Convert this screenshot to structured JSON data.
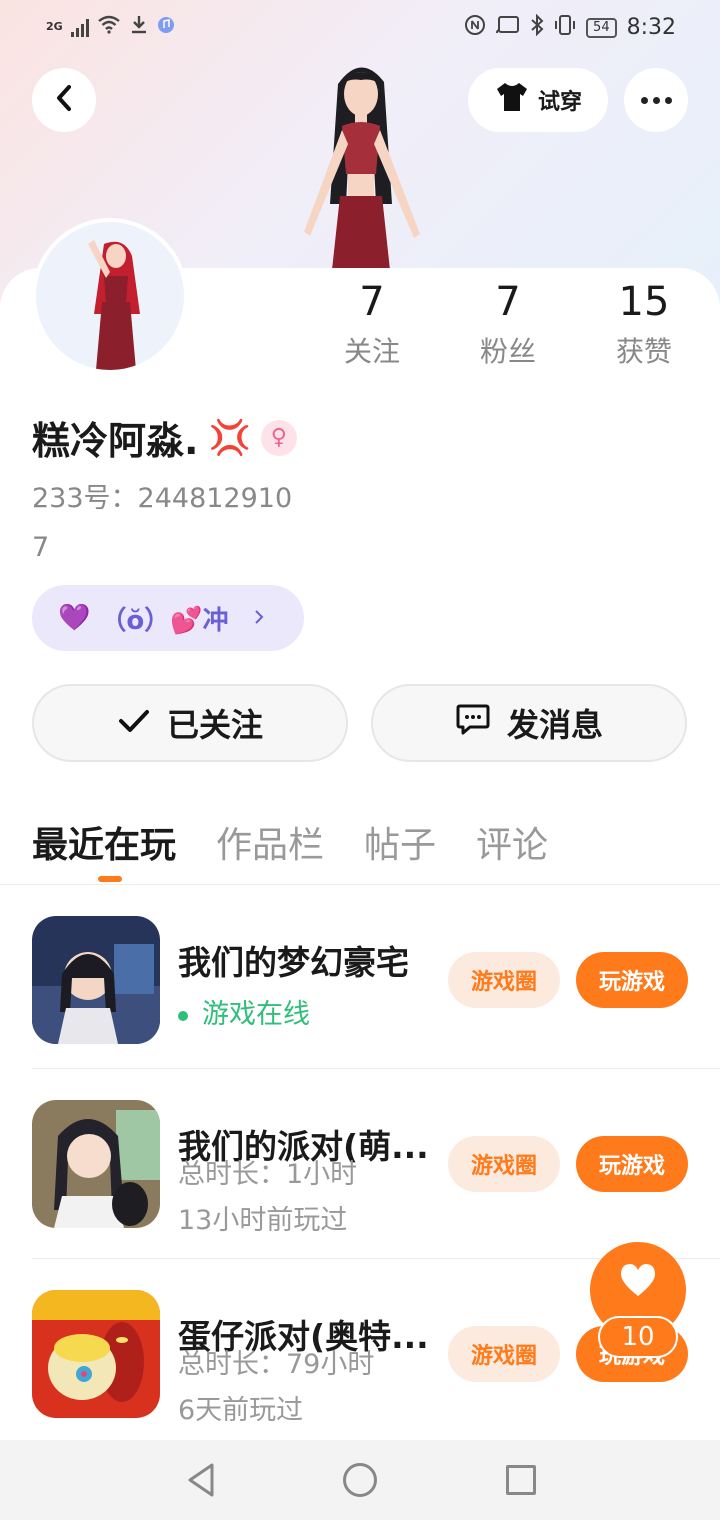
{
  "status_bar": {
    "network": "2G",
    "battery": "54",
    "time": "8:32"
  },
  "header": {
    "try_on_label": "试穿"
  },
  "profile": {
    "stats": [
      {
        "value": "7",
        "label": "关注"
      },
      {
        "value": "7",
        "label": "粉丝"
      },
      {
        "value": "15",
        "label": "获赞"
      }
    ],
    "username": "糕冷阿淼.",
    "username_emoji": "💢",
    "gender_symbol": "♀",
    "id_line": "233号：244812910",
    "bio": "7",
    "tag_chip": "（ŏ）💕冲",
    "tag_chip_icon": "💜"
  },
  "actions": {
    "follow_label": "已关注",
    "message_label": "发消息"
  },
  "tabs": [
    {
      "label": "最近在玩",
      "active": true
    },
    {
      "label": "作品栏",
      "active": false
    },
    {
      "label": "帖子",
      "active": false
    },
    {
      "label": "评论",
      "active": false
    }
  ],
  "games": [
    {
      "title": "我们的梦幻豪宅",
      "line1": "游戏在线",
      "line2": "",
      "online": true,
      "circle_label": "游戏圈",
      "play_label": "玩游戏"
    },
    {
      "title": "我们的派对(萌...",
      "line1": "总时长：1小时",
      "line2": "13小时前玩过",
      "online": false,
      "circle_label": "游戏圈",
      "play_label": "玩游戏"
    },
    {
      "title": "蛋仔派对(奥特...",
      "line1": "总时长：79小时",
      "line2": "6天前玩过",
      "online": false,
      "circle_label": "游戏圈",
      "play_label": "玩游戏"
    }
  ],
  "like_fab": {
    "count": "10"
  },
  "colors": {
    "accent": "#ff7a1a",
    "online": "#2fbf7a",
    "chip_bg": "#ebe8fb",
    "chip_text": "#6b5fd6"
  }
}
